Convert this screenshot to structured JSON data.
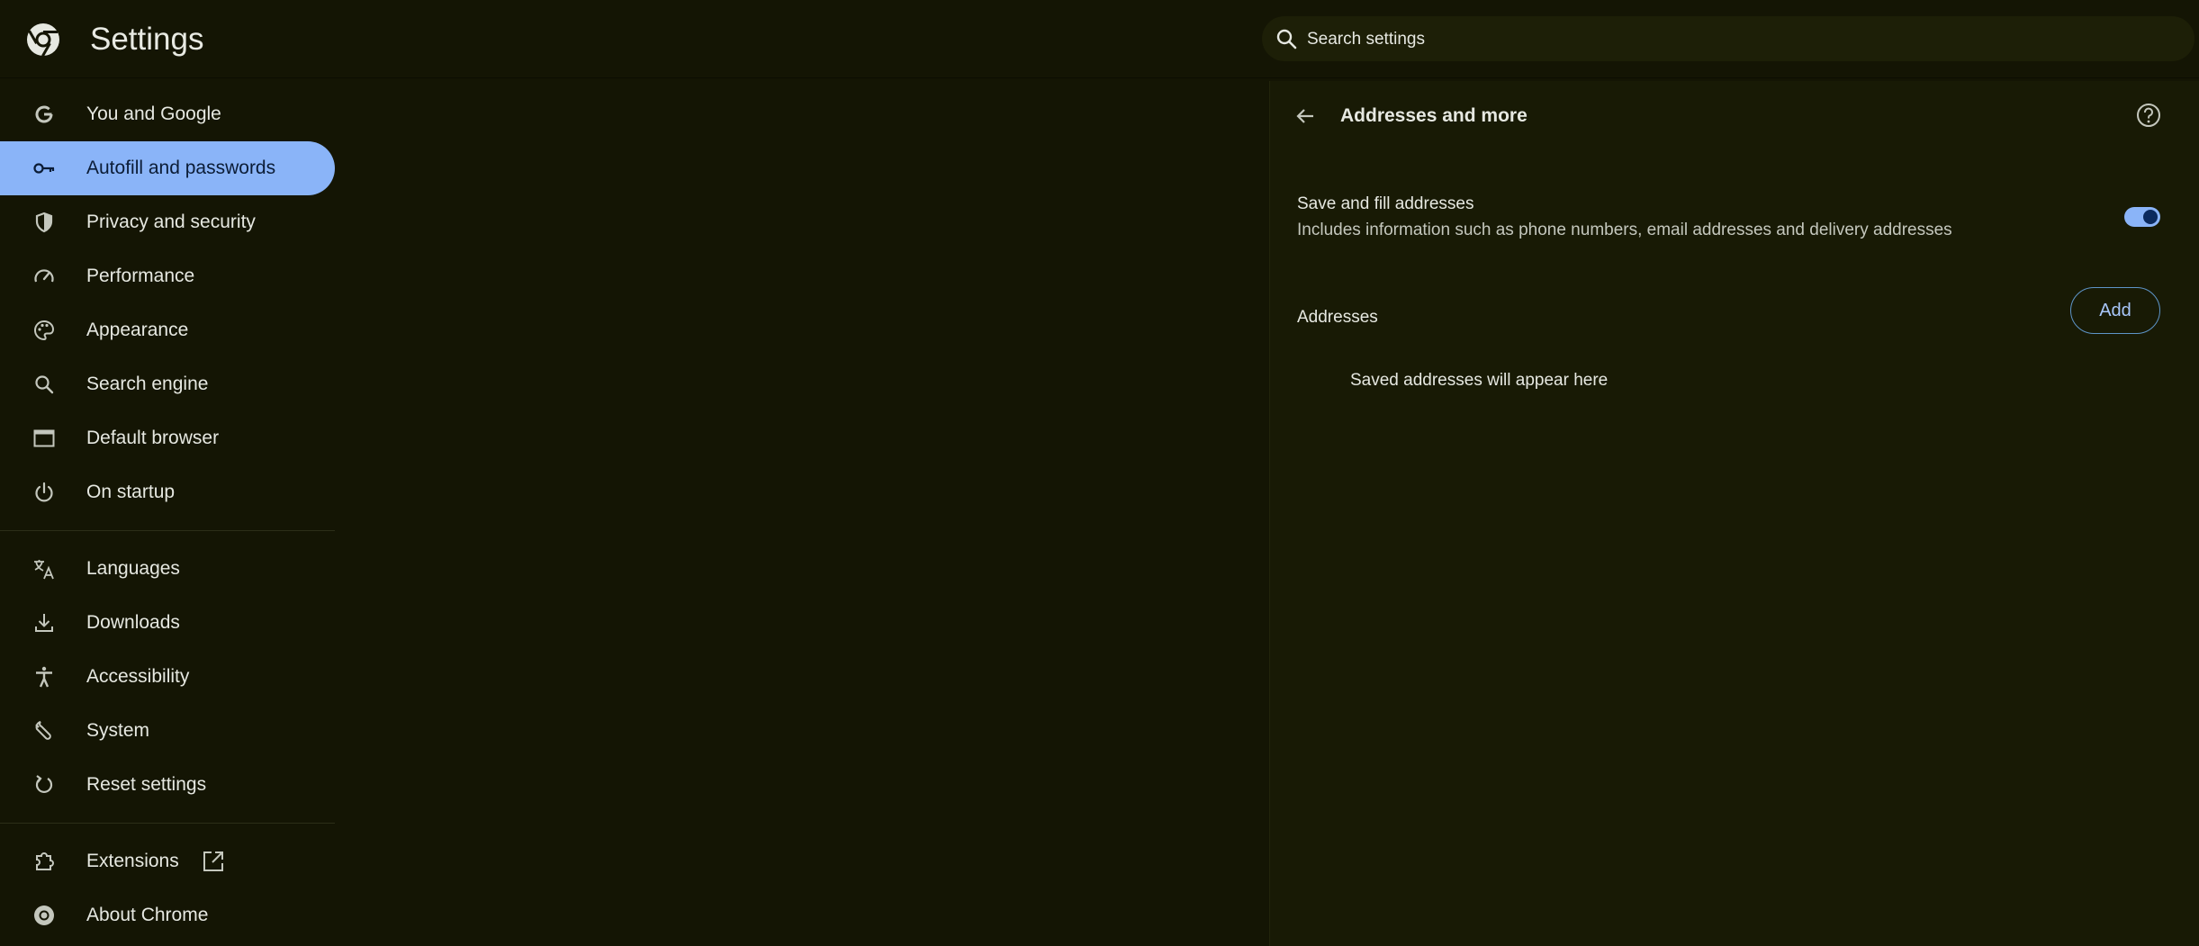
{
  "app": {
    "title": "Settings"
  },
  "search": {
    "placeholder": "Search settings",
    "icon": "search-icon"
  },
  "sidebar": {
    "items": [
      {
        "label": "You and Google",
        "icon": "google-g-icon",
        "active": false
      },
      {
        "label": "Autofill and passwords",
        "icon": "key-icon",
        "active": true
      },
      {
        "label": "Privacy and security",
        "icon": "shield-icon",
        "active": false
      },
      {
        "label": "Performance",
        "icon": "speedometer-icon",
        "active": false
      },
      {
        "label": "Appearance",
        "icon": "palette-icon",
        "active": false
      },
      {
        "label": "Search engine",
        "icon": "magnifier-icon",
        "active": false
      },
      {
        "label": "Default browser",
        "icon": "browser-window-icon",
        "active": false
      },
      {
        "label": "On startup",
        "icon": "power-icon",
        "active": false
      },
      {
        "label": "Languages",
        "icon": "translate-icon",
        "active": false
      },
      {
        "label": "Downloads",
        "icon": "download-icon",
        "active": false
      },
      {
        "label": "Accessibility",
        "icon": "accessibility-icon",
        "active": false
      },
      {
        "label": "System",
        "icon": "wrench-icon",
        "active": false
      },
      {
        "label": "Reset settings",
        "icon": "reset-icon",
        "active": false
      },
      {
        "label": "Extensions",
        "icon": "puzzle-icon",
        "active": false
      },
      {
        "label": "About Chrome",
        "icon": "chrome-icon",
        "active": false
      }
    ]
  },
  "panel": {
    "title": "Addresses and more",
    "save_fill": {
      "title": "Save and fill addresses",
      "description": "Includes information such as phone numbers, email addresses and delivery addresses",
      "enabled": true
    },
    "addresses": {
      "title": "Addresses",
      "add_label": "Add",
      "empty_message": "Saved addresses will appear here"
    }
  },
  "colors": {
    "background": "#141504",
    "panel": "#181a05",
    "accent": "#8ab4f8",
    "text": "#e6e8e1"
  }
}
